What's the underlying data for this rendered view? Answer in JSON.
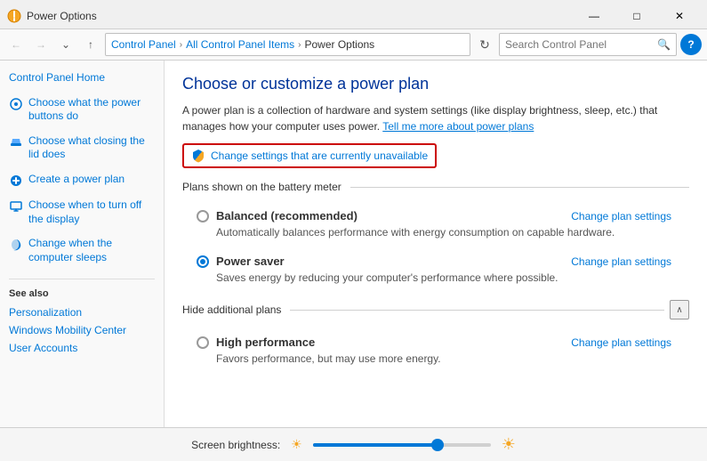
{
  "titlebar": {
    "title": "Power Options",
    "icon": "⚡",
    "min_label": "—",
    "max_label": "□",
    "close_label": "✕"
  },
  "addressbar": {
    "back_tooltip": "Back",
    "forward_tooltip": "Forward",
    "up_tooltip": "Up",
    "breadcrumb": {
      "parts": [
        "Control Panel",
        "All Control Panel Items",
        "Power Options"
      ]
    },
    "search_placeholder": "Search Control Panel",
    "refresh_label": "⟳"
  },
  "sidebar": {
    "items": [
      {
        "id": "control-panel-home",
        "label": "Control Panel Home",
        "has_icon": false
      },
      {
        "id": "power-buttons",
        "label": "Choose what the power buttons do",
        "has_icon": true
      },
      {
        "id": "closing-lid",
        "label": "Choose what closing the lid does",
        "has_icon": true
      },
      {
        "id": "create-plan",
        "label": "Create a power plan",
        "has_icon": true
      },
      {
        "id": "turn-off-display",
        "label": "Choose when to turn off the display",
        "has_icon": true
      },
      {
        "id": "computer-sleeps",
        "label": "Change when the computer sleeps",
        "has_icon": true
      }
    ],
    "see_also_label": "See also",
    "see_also_links": [
      "Personalization",
      "Windows Mobility Center",
      "User Accounts"
    ]
  },
  "content": {
    "title": "Choose or customize a power plan",
    "description": "A power plan is a collection of hardware and system settings (like display brightness, sleep, etc.) that manages how your computer uses power.",
    "learn_more_link": "Tell me more about power plans",
    "change_settings_label": "Change settings that are currently unavailable",
    "plans_section_label": "Plans shown on the battery meter",
    "plans": [
      {
        "id": "balanced",
        "name": "Balanced (recommended)",
        "description": "Automatically balances performance with energy consumption on capable hardware.",
        "selected": false,
        "change_link": "Change plan settings"
      },
      {
        "id": "power-saver",
        "name": "Power saver",
        "description": "Saves energy by reducing your computer's performance where possible.",
        "selected": true,
        "change_link": "Change plan settings"
      }
    ],
    "hide_plans_label": "Hide additional plans",
    "additional_plans": [
      {
        "id": "high-performance",
        "name": "High performance",
        "description": "Favors performance, but may use more energy.",
        "selected": false,
        "change_link": "Change plan settings"
      }
    ]
  },
  "bottombar": {
    "brightness_label": "Screen brightness:",
    "brightness_value": 70
  }
}
